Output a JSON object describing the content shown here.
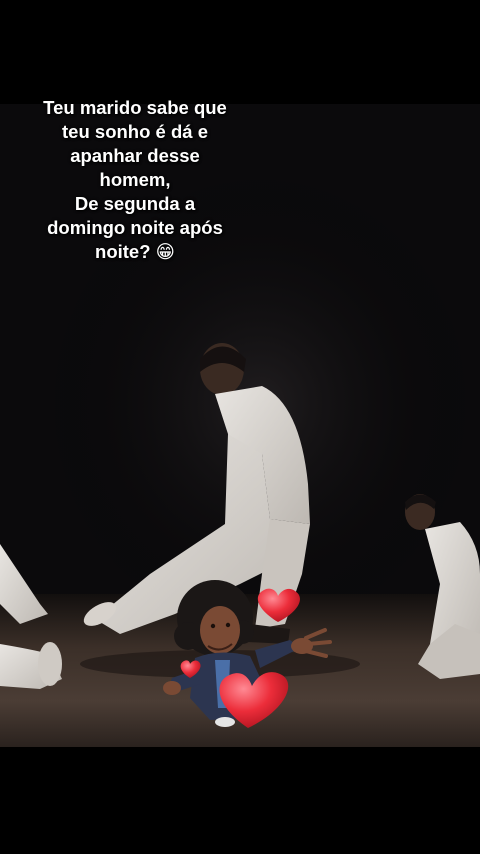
{
  "caption": {
    "lines": [
      "Teu marido sabe que",
      "teu sonho é dá e",
      "apanhar desse",
      "homem,",
      "De segunda a",
      "domingo noite após",
      "noite? 😁"
    ]
  },
  "colors": {
    "background": "#000000",
    "stage_dark": "#0e0d0f",
    "floor": "#4a3c34",
    "outfit": "#d9d6d2",
    "heart": "#e8222e",
    "caption_text": "#ffffff"
  },
  "sticker": {
    "icon": "memoji-hug-hearts-sticker"
  }
}
